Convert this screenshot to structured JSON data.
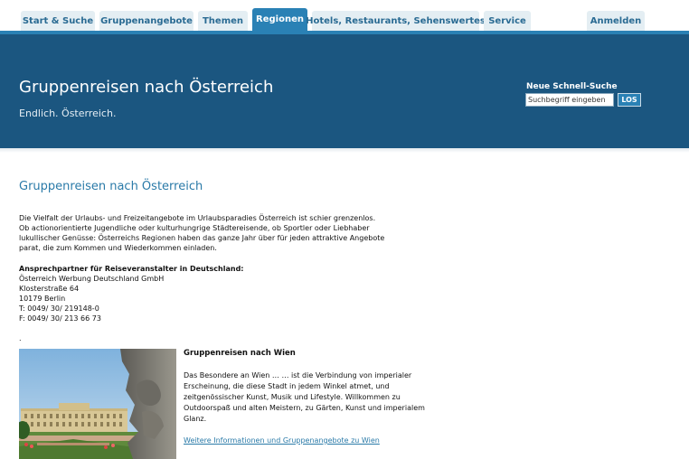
{
  "nav": {
    "tabs": [
      {
        "label": "Start & Suche",
        "active": false
      },
      {
        "label": "Gruppenangebote",
        "active": false
      },
      {
        "label": "Themen",
        "active": false
      },
      {
        "label": "Regionen",
        "active": true
      },
      {
        "label": "Hotels, Restaurants, Sehenswertes",
        "active": false
      },
      {
        "label": "Service",
        "active": false
      },
      {
        "label": "Anmelden",
        "active": false
      }
    ]
  },
  "header": {
    "title": "Gruppenreisen nach Österreich",
    "subtitle": "Endlich. Österreich."
  },
  "search": {
    "label": "Neue Schnell-Suche",
    "value": "Suchbegriff eingeben",
    "button_label": "LOS"
  },
  "colors": {
    "nav_accent": "#2a81b5",
    "header_background": "#1b5680",
    "link": "#2a7aa8",
    "tab_background": "#e4eef3"
  },
  "main": {
    "title": "Gruppenreisen nach Österreich",
    "intro_lines": [
      "Die Vielfalt der Urlaubs- und Freizeitangebote im Urlaubsparadies Österreich ist schier grenzenlos.",
      "Ob actionorientierte Jugendliche oder kulturhungrige Städtereisende, ob Sportler oder Liebhaber",
      "lukullischer Genüsse: Österreichs Regionen haben das ganze Jahr über für jeden attraktive Angebote",
      "parat, die zum Kommen und Wiederkommen einladen."
    ],
    "contact": {
      "heading": "Ansprechpartner für Reiseveranstalter in Deutschland:",
      "lines": [
        "Österreich Werbung Deutschland GmbH",
        "Klosterstraße 64",
        "10179 Berlin",
        "T: 0049/ 30/ 219148-0",
        "F: 0049/ 30/ 213 66 73"
      ]
    },
    "separator": ".",
    "card": {
      "title": "Gruppenreisen nach Wien",
      "body_lines": [
        "Das Besondere an Wien … … ist die Verbindung von imperialer",
        "Erscheinung, die diese Stadt in jedem Winkel atmet, und",
        "zeitgenössischer Kunst, Musik und Lifestyle. Willkommen zu",
        "Outdoorspaß und alten Meistern, zu Gärten, Kunst und imperialem",
        "Glanz."
      ],
      "link": "Weitere Informationen und Gruppenangebote zu Wien"
    }
  }
}
